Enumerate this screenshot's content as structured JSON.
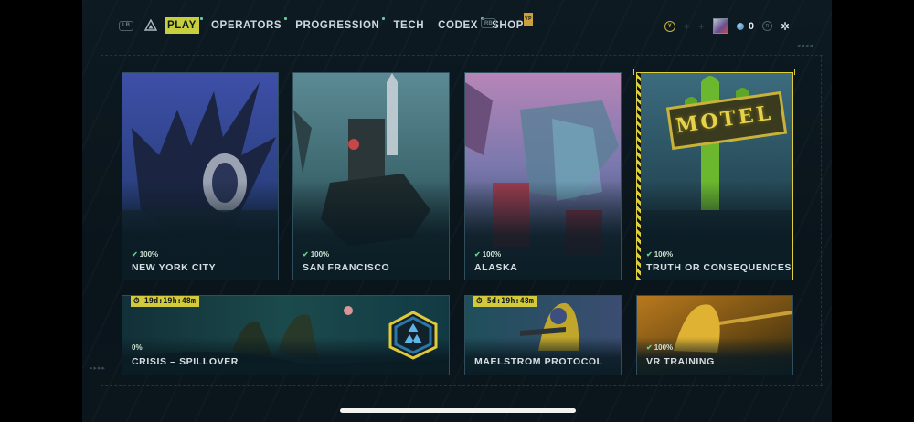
{
  "nav": {
    "lb": "LB",
    "rb": "RB",
    "tabs": [
      {
        "label": "PLAY",
        "active": true
      },
      {
        "label": "OPERATORS",
        "active": false
      },
      {
        "label": "PROGRESSION",
        "active": false
      },
      {
        "label": "TECH",
        "active": false
      },
      {
        "label": "CODEX",
        "active": false
      },
      {
        "label": "SHOP",
        "active": false,
        "badge": "VP"
      }
    ]
  },
  "hud": {
    "y_button": "Y",
    "currency_value": "0",
    "small_button": "R"
  },
  "cards": {
    "nyc": {
      "progress": "100%",
      "title": "NEW YORK CITY"
    },
    "sf": {
      "progress": "100%",
      "title": "SAN FRANCISCO"
    },
    "alaska": {
      "progress": "100%",
      "title": "ALASKA"
    },
    "truth": {
      "progress": "100%",
      "title": "TRUTH OR CONSEQUENCES",
      "sign": "MOTEL"
    },
    "crisis": {
      "timer": "19d:19h:48m",
      "progress": "0%",
      "title": "CRISIS – SPILLOVER"
    },
    "maelstrom": {
      "timer": "5d:19h:48m",
      "title": "MAELSTROM PROTOCOL"
    },
    "vr": {
      "progress": "100%",
      "title": "VR TRAINING"
    }
  },
  "colors": {
    "accent": "#c7cf3f",
    "check": "#63d08d",
    "selected": "#e0cf3c"
  }
}
